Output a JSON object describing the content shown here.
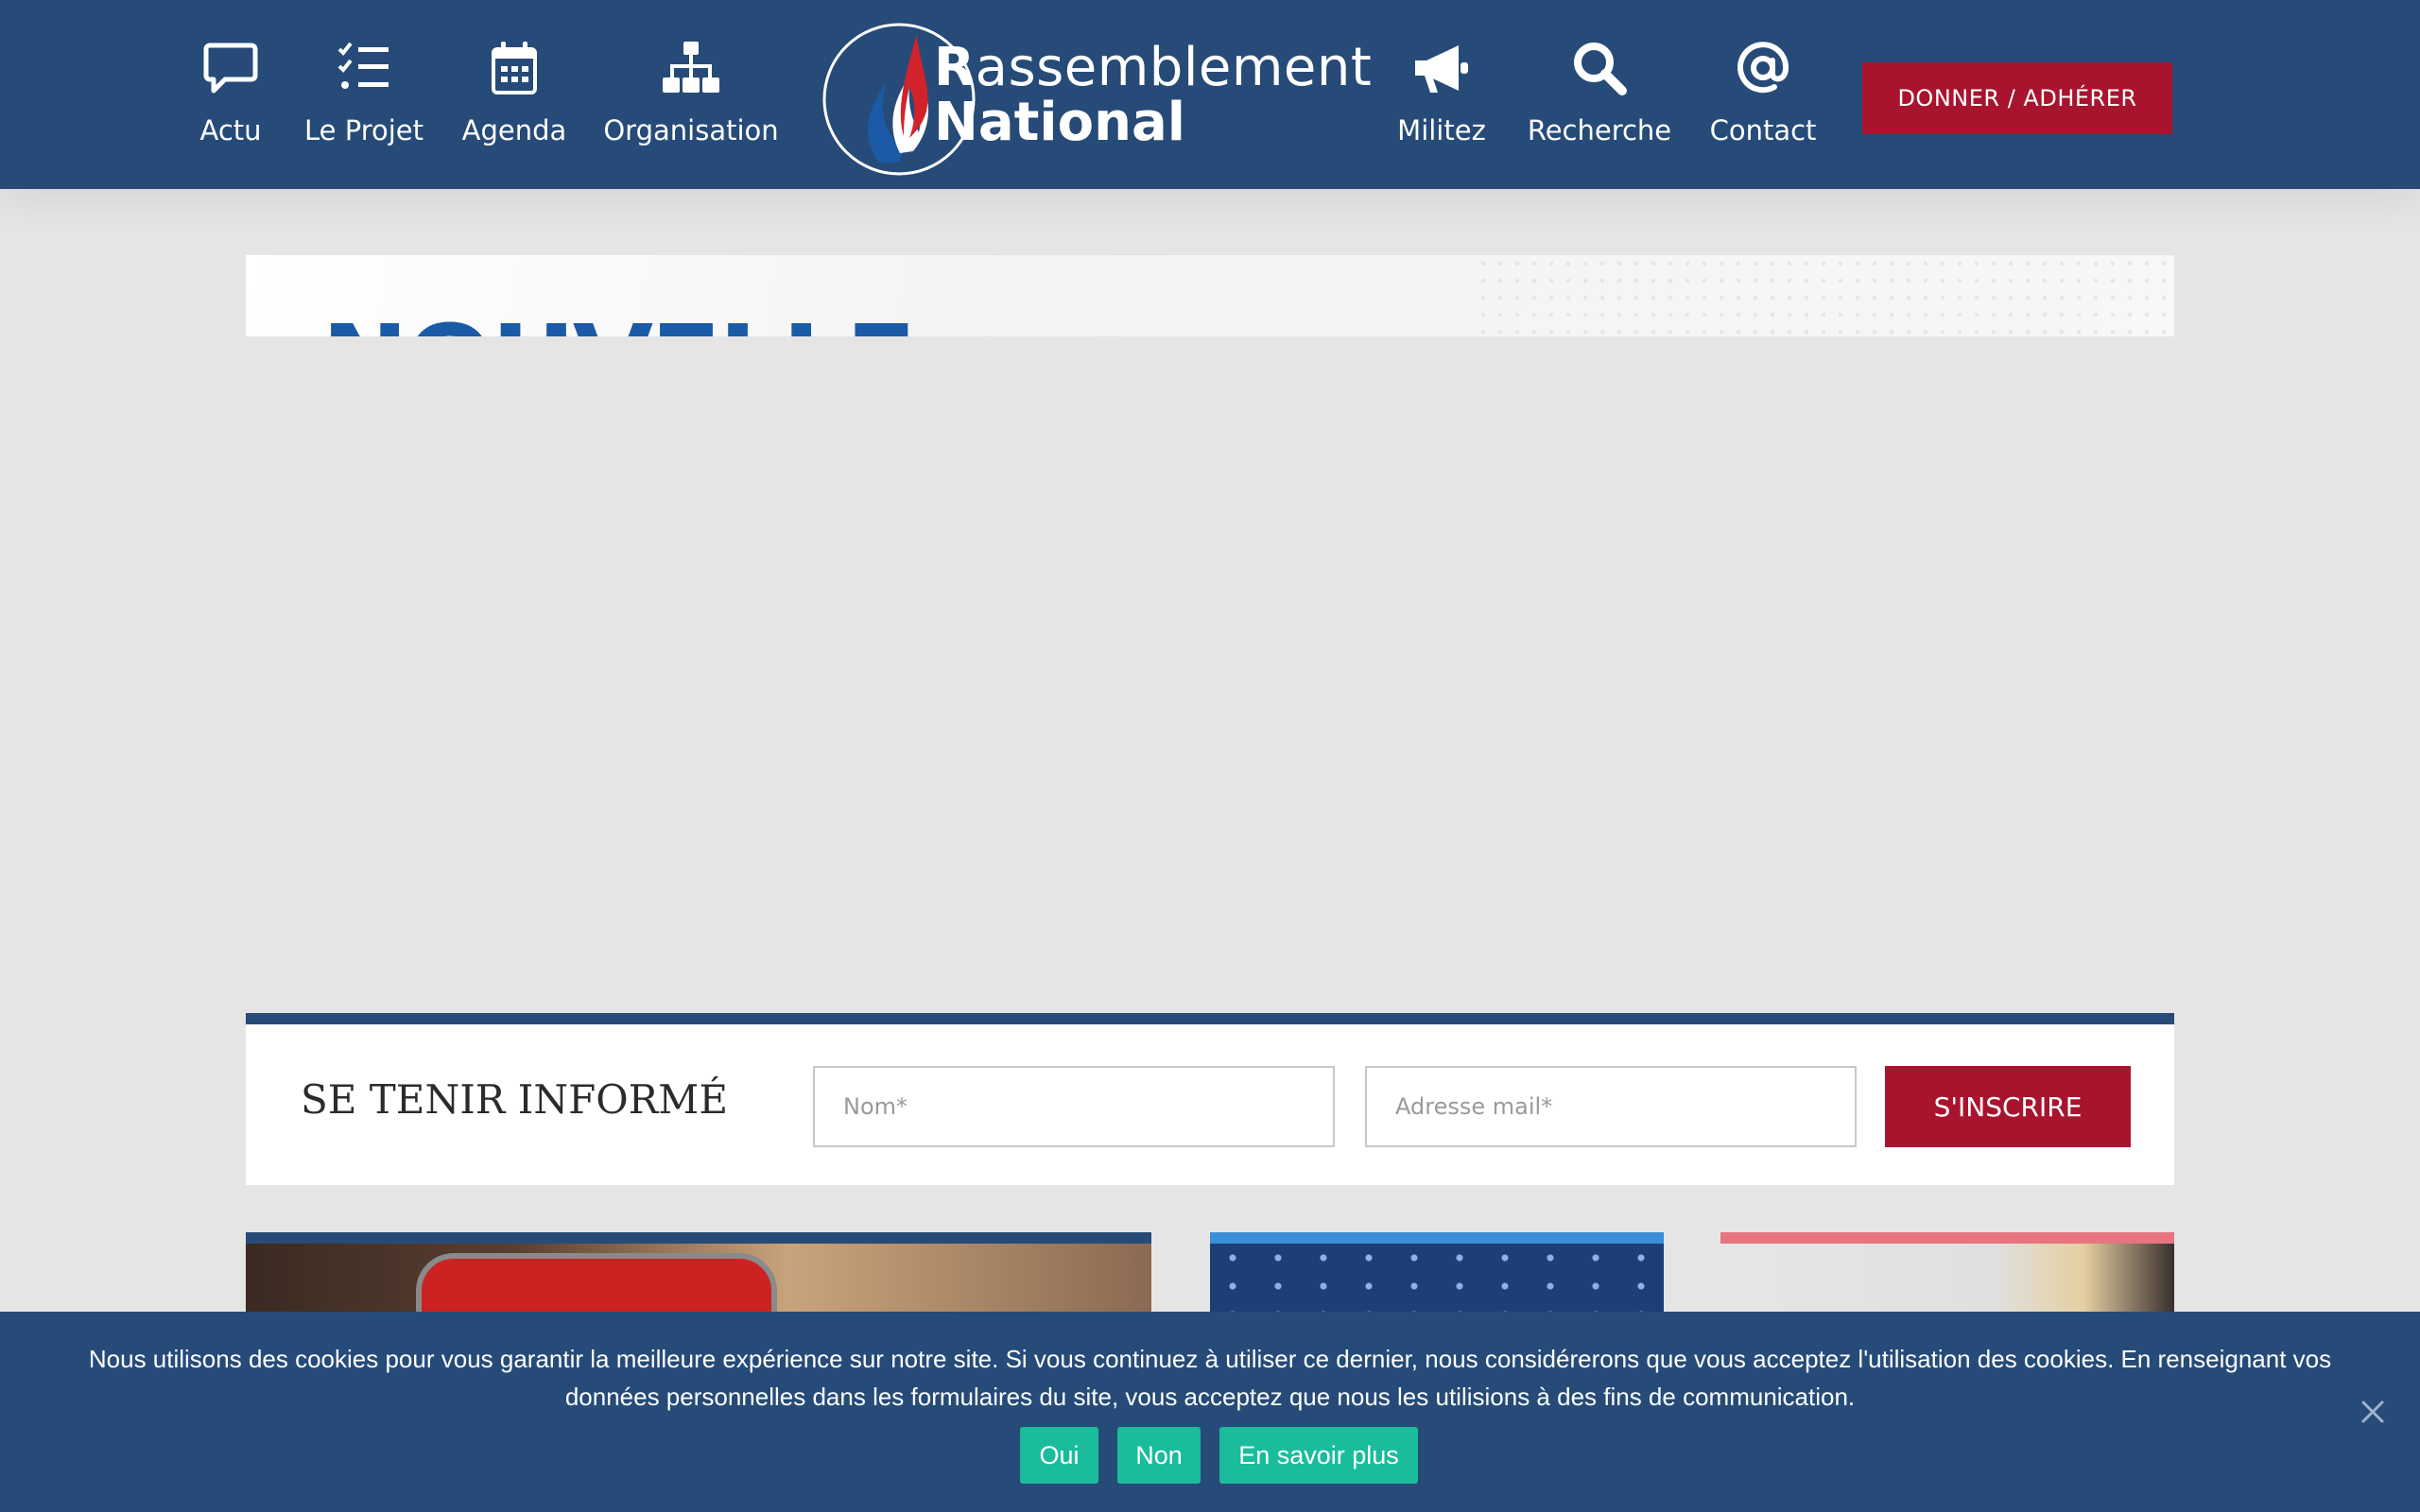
{
  "header": {
    "nav_left": [
      {
        "label": "Actu",
        "icon": "chat-bubble-icon"
      },
      {
        "label": "Le Projet",
        "icon": "checklist-icon"
      },
      {
        "label": "Agenda",
        "icon": "calendar-icon"
      },
      {
        "label": "Organisation",
        "icon": "org-chart-icon"
      }
    ],
    "logo": {
      "line1_initial": "R",
      "line1_rest": "assemblement",
      "line2": "National"
    },
    "nav_right": [
      {
        "label": "Militez",
        "icon": "megaphone-icon"
      },
      {
        "label": "Recherche",
        "icon": "search-icon"
      },
      {
        "label": "Contact",
        "icon": "at-sign-icon"
      }
    ],
    "donate_label": "DONNER / ADHÉRER"
  },
  "hero": {
    "heading": "NOUVELLE"
  },
  "newsletter": {
    "title": "SE TENIR INFORMÉ",
    "name_placeholder": "Nom*",
    "email_placeholder": "Adresse mail*",
    "submit_label": "S'INSCRIRE"
  },
  "cookie_banner": {
    "message": "Nous utilisons des cookies pour vous garantir la meilleure expérience sur notre site. Si vous continuez à utiliser ce dernier, nous considérerons que vous acceptez l'utilisation des cookies. En renseignant vos données personnelles dans les formulaires du site, vous acceptez que nous les utilisions à des fins de communication.",
    "yes_label": "Oui",
    "no_label": "Non",
    "more_label": "En savoir plus"
  },
  "colors": {
    "header_bg": "#264b78",
    "accent_red": "#a8142e",
    "cookie_button": "#1abc9c",
    "page_bg": "#e5e5e5"
  }
}
